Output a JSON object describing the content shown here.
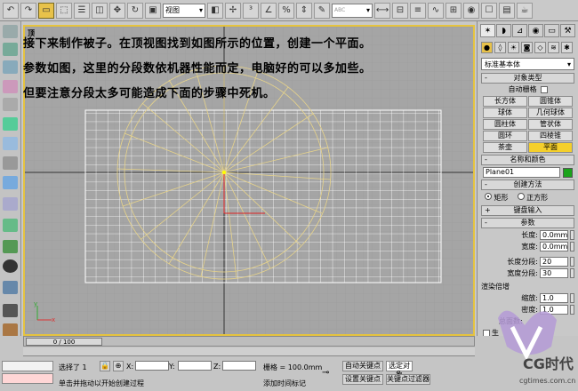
{
  "toolbar": {
    "view_dropdown": "视图",
    "selection_set_placeholder": "ABC"
  },
  "viewport": {
    "label": "顶",
    "instructions": [
      "接下来制作被子。在顶视图找到如图所示的位置，创建一个平面。",
      "参数如图，这里的分段数依机器性能而定，电脑好的可以多加些。",
      "但要注意分段太多可能造成下面的步骤中死机。"
    ],
    "axis_y": "y",
    "axis_x": "x"
  },
  "command_panel": {
    "category_dropdown": "标准基本体",
    "object_type": {
      "title": "对象类型",
      "autogrid_label": "自动栅格",
      "buttons": [
        "长方体",
        "圆锥体",
        "球体",
        "几何球体",
        "圆柱体",
        "管状体",
        "圆环",
        "四棱锥",
        "茶壶",
        "平面"
      ],
      "active": "平面"
    },
    "name_color": {
      "title": "名称和颜色",
      "name": "Plane01",
      "color": "#1aa31a"
    },
    "creation_method": {
      "title": "创建方法",
      "options": [
        "矩形",
        "正方形"
      ],
      "selected": "矩形"
    },
    "keyboard_entry": {
      "title": "键盘输入"
    },
    "parameters": {
      "title": "参数",
      "length_label": "长度:",
      "length_value": "0.0mm",
      "width_label": "宽度:",
      "width_value": "0.0mm",
      "length_segs_label": "长度分段:",
      "length_segs_value": "20",
      "width_segs_label": "宽度分段:",
      "width_segs_value": "30",
      "render_mult_title": "渲染倍增",
      "scale_label": "缩放:",
      "scale_value": "1.0",
      "density_label": "密度:",
      "density_value": "1.0",
      "total_faces_label": "总面数:",
      "gen_coords_label": "生"
    }
  },
  "timeline": {
    "slider_label": "0 / 100",
    "progress": 0.0
  },
  "statusbar": {
    "selected_text": "选择了 1",
    "x_label": "X:",
    "y_label": "Y:",
    "z_label": "Z:",
    "grid_text": "栅格 = 100.0mm",
    "auto_key": "自动关键点",
    "selected_obj": "选定对象",
    "set_key": "设置关键点",
    "key_filter": "关键点过滤器",
    "prompt": "单击并拖动以开始创建过程",
    "add_time_tag": "添加时间标记"
  },
  "watermark": {
    "brand": "CG时代",
    "url": "cgtimes.com.cn"
  }
}
